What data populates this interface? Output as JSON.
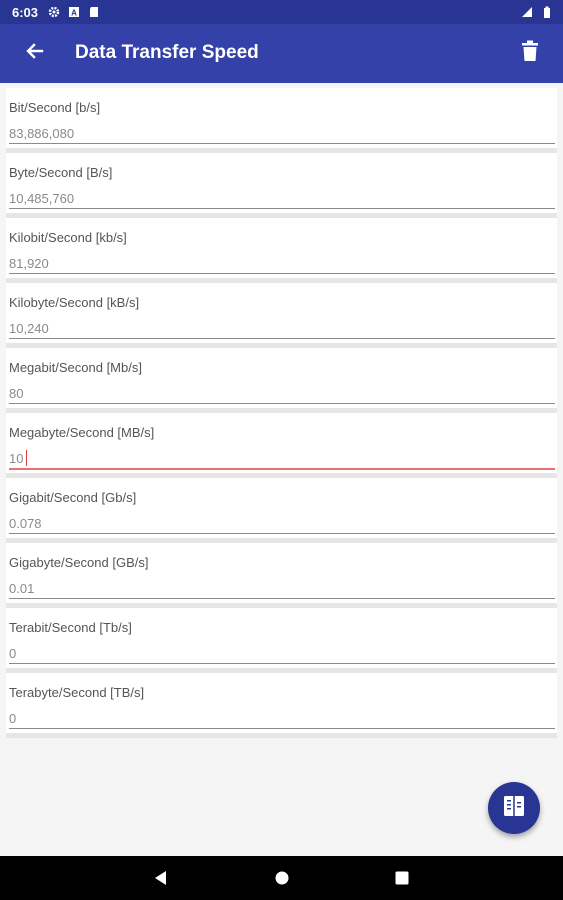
{
  "status_bar": {
    "time": "6:03",
    "left_icons": [
      "gear-icon",
      "a-badge-icon",
      "sd-card-icon"
    ],
    "right_icons": [
      "signal-icon",
      "battery-icon"
    ]
  },
  "app_bar": {
    "title": "Data Transfer Speed",
    "back_icon": "arrow-back-icon",
    "delete_icon": "trash-icon"
  },
  "fields": [
    {
      "label": "Bit/Second [b/s]",
      "value": "83,886,080"
    },
    {
      "label": "Byte/Second [B/s]",
      "value": "10,485,760"
    },
    {
      "label": "Kilobit/Second [kb/s]",
      "value": "81,920"
    },
    {
      "label": "Kilobyte/Second [kB/s]",
      "value": "10,240"
    },
    {
      "label": "Megabit/Second [Mb/s]",
      "value": "80"
    },
    {
      "label": "Megabyte/Second [MB/s]",
      "value": "10"
    },
    {
      "label": "Gigabit/Second [Gb/s]",
      "value": "0.078"
    },
    {
      "label": "Gigabyte/Second [GB/s]",
      "value": "0.01"
    },
    {
      "label": "Terabit/Second [Tb/s]",
      "value": "0"
    },
    {
      "label": "Terabyte/Second [TB/s]",
      "value": "0"
    }
  ],
  "active_field_index": 5,
  "fab": {
    "icon": "converter-icon"
  },
  "colors": {
    "status_bar": "#283593",
    "app_bar": "#3341a8",
    "fab": "#283593",
    "active_underline": "#e57373"
  }
}
